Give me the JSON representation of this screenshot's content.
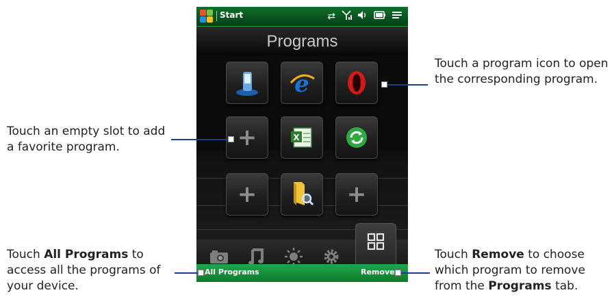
{
  "status_bar": {
    "start_label": "Start",
    "icons": [
      "sync-icon",
      "signal-icon",
      "volume-icon",
      "battery-icon",
      "menu-icon"
    ]
  },
  "programs_title": "Programs",
  "tiles": [
    {
      "name": "device-program-icon",
      "kind": "program"
    },
    {
      "name": "internet-explorer-icon",
      "kind": "program"
    },
    {
      "name": "opera-browser-icon",
      "kind": "program"
    },
    {
      "name": "empty-slot",
      "kind": "empty",
      "glyph": "+"
    },
    {
      "name": "excel-icon",
      "kind": "program"
    },
    {
      "name": "sync-program-icon",
      "kind": "program"
    },
    {
      "name": "empty-slot",
      "kind": "empty",
      "glyph": "+"
    },
    {
      "name": "file-explorer-icon",
      "kind": "program"
    },
    {
      "name": "empty-slot",
      "kind": "empty",
      "glyph": "+"
    }
  ],
  "tabs": [
    "camera-icon",
    "music-icon",
    "weather-icon",
    "settings-icon",
    "programs-grid-icon"
  ],
  "softkeys": {
    "left": "All Programs",
    "right": "Remove"
  },
  "callouts": {
    "program_icon": "Touch a program icon to open the corresponding program.",
    "empty_slot": "Touch an empty slot to add a favorite program.",
    "all_programs": {
      "prefix": "Touch ",
      "bold": "All Programs",
      "suffix": " to access all the programs of your device."
    },
    "remove": {
      "prefix": "Touch ",
      "bold1": "Remove",
      "middle": " to choose which program to remove from the ",
      "bold2": "Programs",
      "suffix": " tab."
    }
  },
  "colors": {
    "status_green": "#0f6f2a",
    "softkey_green": "#22a64a",
    "leader_blue": "#1c3f8a"
  }
}
